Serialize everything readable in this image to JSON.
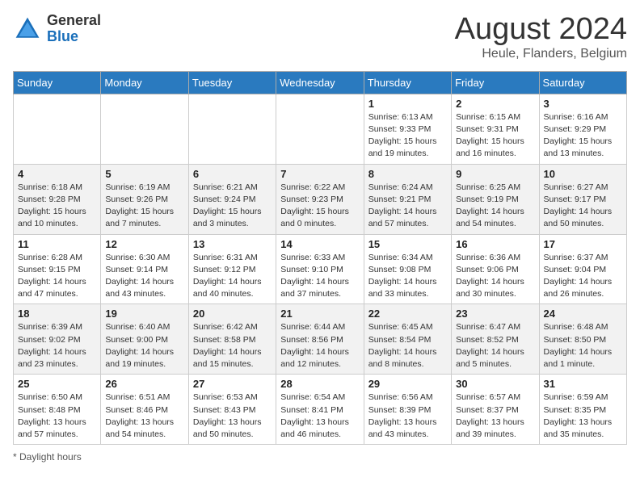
{
  "header": {
    "logo_general": "General",
    "logo_blue": "Blue",
    "month_title": "August 2024",
    "location": "Heule, Flanders, Belgium"
  },
  "weekdays": [
    "Sunday",
    "Monday",
    "Tuesday",
    "Wednesday",
    "Thursday",
    "Friday",
    "Saturday"
  ],
  "weeks": [
    [
      {
        "day": "",
        "detail": ""
      },
      {
        "day": "",
        "detail": ""
      },
      {
        "day": "",
        "detail": ""
      },
      {
        "day": "",
        "detail": ""
      },
      {
        "day": "1",
        "detail": "Sunrise: 6:13 AM\nSunset: 9:33 PM\nDaylight: 15 hours\nand 19 minutes."
      },
      {
        "day": "2",
        "detail": "Sunrise: 6:15 AM\nSunset: 9:31 PM\nDaylight: 15 hours\nand 16 minutes."
      },
      {
        "day": "3",
        "detail": "Sunrise: 6:16 AM\nSunset: 9:29 PM\nDaylight: 15 hours\nand 13 minutes."
      }
    ],
    [
      {
        "day": "4",
        "detail": "Sunrise: 6:18 AM\nSunset: 9:28 PM\nDaylight: 15 hours\nand 10 minutes."
      },
      {
        "day": "5",
        "detail": "Sunrise: 6:19 AM\nSunset: 9:26 PM\nDaylight: 15 hours\nand 7 minutes."
      },
      {
        "day": "6",
        "detail": "Sunrise: 6:21 AM\nSunset: 9:24 PM\nDaylight: 15 hours\nand 3 minutes."
      },
      {
        "day": "7",
        "detail": "Sunrise: 6:22 AM\nSunset: 9:23 PM\nDaylight: 15 hours\nand 0 minutes."
      },
      {
        "day": "8",
        "detail": "Sunrise: 6:24 AM\nSunset: 9:21 PM\nDaylight: 14 hours\nand 57 minutes."
      },
      {
        "day": "9",
        "detail": "Sunrise: 6:25 AM\nSunset: 9:19 PM\nDaylight: 14 hours\nand 54 minutes."
      },
      {
        "day": "10",
        "detail": "Sunrise: 6:27 AM\nSunset: 9:17 PM\nDaylight: 14 hours\nand 50 minutes."
      }
    ],
    [
      {
        "day": "11",
        "detail": "Sunrise: 6:28 AM\nSunset: 9:15 PM\nDaylight: 14 hours\nand 47 minutes."
      },
      {
        "day": "12",
        "detail": "Sunrise: 6:30 AM\nSunset: 9:14 PM\nDaylight: 14 hours\nand 43 minutes."
      },
      {
        "day": "13",
        "detail": "Sunrise: 6:31 AM\nSunset: 9:12 PM\nDaylight: 14 hours\nand 40 minutes."
      },
      {
        "day": "14",
        "detail": "Sunrise: 6:33 AM\nSunset: 9:10 PM\nDaylight: 14 hours\nand 37 minutes."
      },
      {
        "day": "15",
        "detail": "Sunrise: 6:34 AM\nSunset: 9:08 PM\nDaylight: 14 hours\nand 33 minutes."
      },
      {
        "day": "16",
        "detail": "Sunrise: 6:36 AM\nSunset: 9:06 PM\nDaylight: 14 hours\nand 30 minutes."
      },
      {
        "day": "17",
        "detail": "Sunrise: 6:37 AM\nSunset: 9:04 PM\nDaylight: 14 hours\nand 26 minutes."
      }
    ],
    [
      {
        "day": "18",
        "detail": "Sunrise: 6:39 AM\nSunset: 9:02 PM\nDaylight: 14 hours\nand 23 minutes."
      },
      {
        "day": "19",
        "detail": "Sunrise: 6:40 AM\nSunset: 9:00 PM\nDaylight: 14 hours\nand 19 minutes."
      },
      {
        "day": "20",
        "detail": "Sunrise: 6:42 AM\nSunset: 8:58 PM\nDaylight: 14 hours\nand 15 minutes."
      },
      {
        "day": "21",
        "detail": "Sunrise: 6:44 AM\nSunset: 8:56 PM\nDaylight: 14 hours\nand 12 minutes."
      },
      {
        "day": "22",
        "detail": "Sunrise: 6:45 AM\nSunset: 8:54 PM\nDaylight: 14 hours\nand 8 minutes."
      },
      {
        "day": "23",
        "detail": "Sunrise: 6:47 AM\nSunset: 8:52 PM\nDaylight: 14 hours\nand 5 minutes."
      },
      {
        "day": "24",
        "detail": "Sunrise: 6:48 AM\nSunset: 8:50 PM\nDaylight: 14 hours\nand 1 minute."
      }
    ],
    [
      {
        "day": "25",
        "detail": "Sunrise: 6:50 AM\nSunset: 8:48 PM\nDaylight: 13 hours\nand 57 minutes."
      },
      {
        "day": "26",
        "detail": "Sunrise: 6:51 AM\nSunset: 8:46 PM\nDaylight: 13 hours\nand 54 minutes."
      },
      {
        "day": "27",
        "detail": "Sunrise: 6:53 AM\nSunset: 8:43 PM\nDaylight: 13 hours\nand 50 minutes."
      },
      {
        "day": "28",
        "detail": "Sunrise: 6:54 AM\nSunset: 8:41 PM\nDaylight: 13 hours\nand 46 minutes."
      },
      {
        "day": "29",
        "detail": "Sunrise: 6:56 AM\nSunset: 8:39 PM\nDaylight: 13 hours\nand 43 minutes."
      },
      {
        "day": "30",
        "detail": "Sunrise: 6:57 AM\nSunset: 8:37 PM\nDaylight: 13 hours\nand 39 minutes."
      },
      {
        "day": "31",
        "detail": "Sunrise: 6:59 AM\nSunset: 8:35 PM\nDaylight: 13 hours\nand 35 minutes."
      }
    ]
  ],
  "footer": {
    "note": "Daylight hours"
  }
}
